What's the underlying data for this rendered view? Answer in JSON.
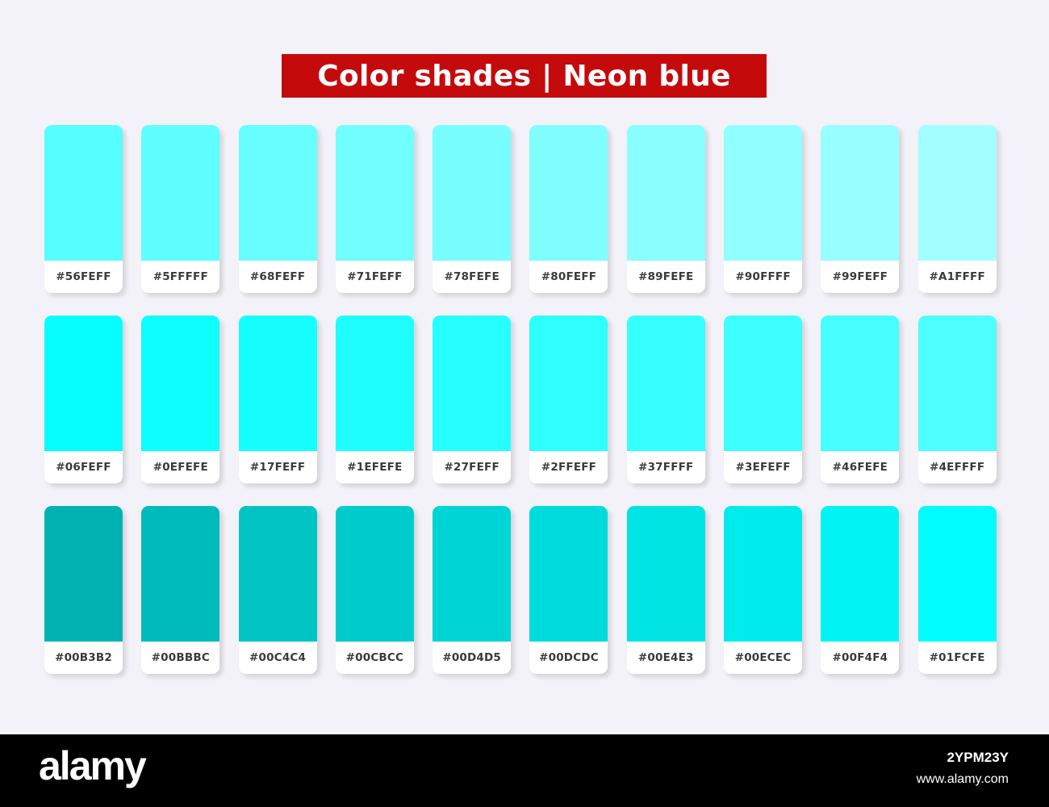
{
  "title": "Color shades | Neon blue",
  "colors": {
    "banner": "#c50a0c",
    "background": "#f3f2f8",
    "card": "#ffffff",
    "code_text": "#3a3a3a"
  },
  "rows": [
    [
      {
        "code": "#56FEFF",
        "color": "#56FEFF"
      },
      {
        "code": "#5FFFFF",
        "color": "#5FFFFF"
      },
      {
        "code": "#68FEFF",
        "color": "#68FEFF"
      },
      {
        "code": "#71FEFF",
        "color": "#71FEFF"
      },
      {
        "code": "#78FEFE",
        "color": "#78FEFE"
      },
      {
        "code": "#80FEFF",
        "color": "#80FEFF"
      },
      {
        "code": "#89FEFE",
        "color": "#89FEFE"
      },
      {
        "code": "#90FFFF",
        "color": "#90FFFF"
      },
      {
        "code": "#99FEFF",
        "color": "#99FEFF"
      },
      {
        "code": "#A1FFFF",
        "color": "#A1FFFF"
      }
    ],
    [
      {
        "code": "#06FEFF",
        "color": "#06FEFF"
      },
      {
        "code": "#0EFEFE",
        "color": "#0EFEFE"
      },
      {
        "code": "#17FEFF",
        "color": "#17FEFF"
      },
      {
        "code": "#1EFEFE",
        "color": "#1EFEFE"
      },
      {
        "code": "#27FEFF",
        "color": "#27FEFF"
      },
      {
        "code": "#2FFEFF",
        "color": "#2FFEFF"
      },
      {
        "code": "#37FFFF",
        "color": "#37FFFF"
      },
      {
        "code": "#3EFEFF",
        "color": "#3EFEFF"
      },
      {
        "code": "#46FEFE",
        "color": "#46FEFE"
      },
      {
        "code": "#4EFFFF",
        "color": "#4EFFFF"
      }
    ],
    [
      {
        "code": "#00B3B2",
        "color": "#00B3B2"
      },
      {
        "code": "#00BBBC",
        "color": "#00BBBC"
      },
      {
        "code": "#00C4C4",
        "color": "#00C4C4"
      },
      {
        "code": "#00CBCC",
        "color": "#00CBCC"
      },
      {
        "code": "#00D4D5",
        "color": "#00D4D5"
      },
      {
        "code": "#00DCDC",
        "color": "#00DCDC"
      },
      {
        "code": "#00E4E3",
        "color": "#00E4E3"
      },
      {
        "code": "#00ECEC",
        "color": "#00ECEC"
      },
      {
        "code": "#00F4F4",
        "color": "#00F4F4"
      },
      {
        "code": "#01FCFE",
        "color": "#01FCFE"
      }
    ]
  ],
  "footer": {
    "logo": "alamy",
    "image_id": "2YPM23Y",
    "site": "www.alamy.com"
  }
}
